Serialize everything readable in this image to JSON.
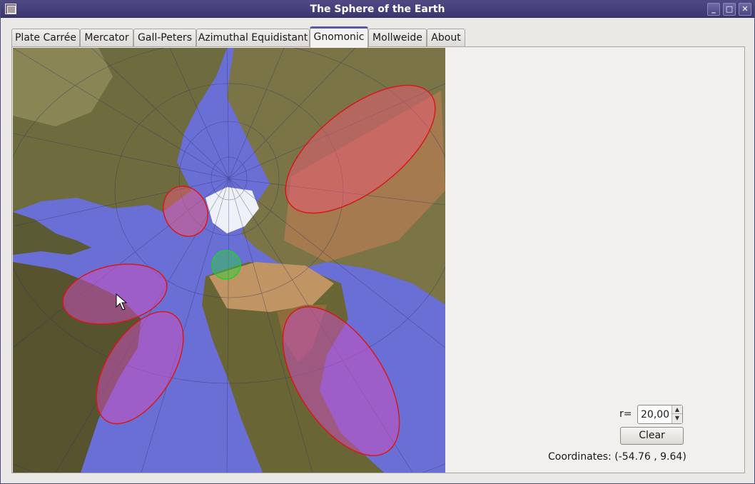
{
  "window": {
    "title": "The Sphere of the Earth",
    "buttons": {
      "minimize": "_",
      "maximize": "□",
      "close": "✕"
    }
  },
  "tabs": [
    {
      "label": "Plate Carrée",
      "active": false
    },
    {
      "label": "Mercator",
      "active": false
    },
    {
      "label": "Gall-Peters",
      "active": false
    },
    {
      "label": "Azimuthal Equidistant",
      "active": false
    },
    {
      "label": "Gnomonic",
      "active": true
    },
    {
      "label": "Mollweide",
      "active": false
    },
    {
      "label": "About",
      "active": false
    }
  ],
  "controls": {
    "r_label": "r=",
    "r_value": "20,00",
    "clear_label": "Clear",
    "coordinates": "Coordinates: (-54.76 , 9.64)"
  },
  "colors": {
    "ocean": "#6a6fd6",
    "land": "#6e6b3e",
    "desert": "#b0825a",
    "circle_red": "#d61a1a",
    "circle_green": "#1bd12a"
  }
}
